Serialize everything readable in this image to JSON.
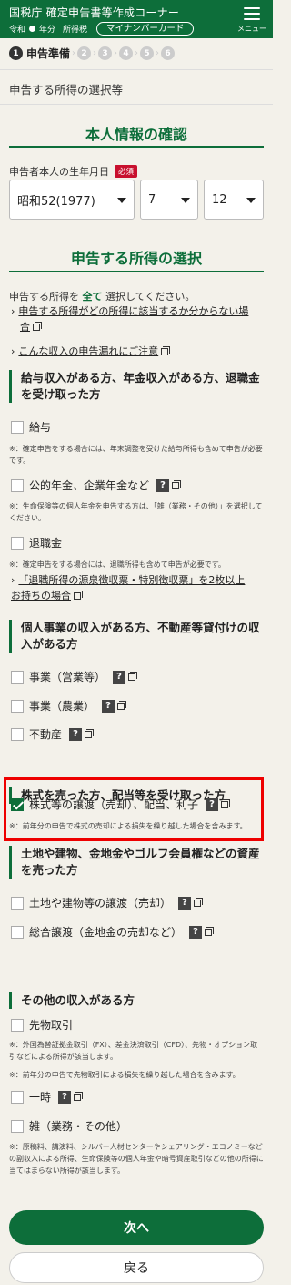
{
  "header": {
    "title": "国税庁 確定申告書等作成コーナー",
    "era": "令和",
    "year_label": "年分",
    "tax_type": "所得税",
    "mynumber_button": "マイナンバーカード",
    "menu_label": "メニュー"
  },
  "steps": {
    "current_number": "1",
    "current_label": "申告準備",
    "others": [
      "2",
      "3",
      "4",
      "5",
      "6"
    ]
  },
  "page_subtitle": "申告する所得の選択等",
  "personal": {
    "heading": "本人情報の確認",
    "birth_label": "申告者本人の生年月日",
    "required_badge": "必須",
    "era_year_value": "昭和52(1977)",
    "month_value": "7",
    "day_value": "12"
  },
  "income": {
    "heading": "申告する所得の選択",
    "intro_pre": "申告する所得を",
    "intro_bold": "全て",
    "intro_post": "選択してください。",
    "link1_line1": "申告する所得がどの所得に該当するか分からない場",
    "link1_line2": "合",
    "link2": "こんな収入の申告漏れにご注意"
  },
  "groups": {
    "salary": {
      "title": "給与収入がある方、年金収入がある方、退職金を受け取った方",
      "items": {
        "salary": "給与",
        "pension": "公的年金、企業年金など",
        "retirement": "退職金"
      },
      "note_salary": "※：確定申告をする場合には、年末調整を受けた給与所得も含めて申告が必要です。",
      "note_pension": "※：生命保険等の個人年金を申告する方は、「雑（業務・その他）」を選択してください。",
      "note_retirement": "※：確定申告をする場合には、退職所得も含めて申告が必要です。",
      "retire_link_line1": "「退職所得の源泉徴収票・特別徴収票」を2枚以上",
      "retire_link_line2": "お持ちの場合"
    },
    "business": {
      "title": "個人事業の収入がある方、不動産等貸付けの収入がある方",
      "items": {
        "business": "事業（営業等）",
        "agriculture": "事業（農業）",
        "real_estate": "不動産"
      }
    },
    "stocks": {
      "title": "株式を売った方、配当等を受け取った方",
      "item": "株式等の譲渡（売却）、配当、利子",
      "note": "※：前年分の申告で株式の売却による損失を繰り越した場合を含みます。"
    },
    "land": {
      "title": "土地や建物、金地金やゴルフ会員権などの資産を売った方",
      "items": {
        "land": "土地や建物等の譲渡（売却）",
        "general": "総合譲渡（金地金の売却など）"
      }
    },
    "other": {
      "title": "その他の収入がある方",
      "items": {
        "futures": "先物取引",
        "temporary": "一時",
        "misc": "雑（業務・その他）"
      },
      "note_futures_1": "※：外国為替証拠金取引（FX）、差金決済取引（CFD）、先物・オプション取引などによる所得が該当します。",
      "note_futures_2": "※：前年分の申告で先物取引による損失を繰り越した場合を含みます。",
      "note_misc": "※：原稿料、講演料、シルバー人材センターやシェアリング・エコノミーなどの副収入による所得、生命保険等の個人年金や暗号資産取引などの他の所得に当てはまらない所得が該当します。"
    }
  },
  "buttons": {
    "next": "次へ",
    "back": "戻る"
  },
  "colors": {
    "brand_green": "#0d6e3a",
    "highlight_red": "#ee0000",
    "required_red": "#c8102e"
  }
}
